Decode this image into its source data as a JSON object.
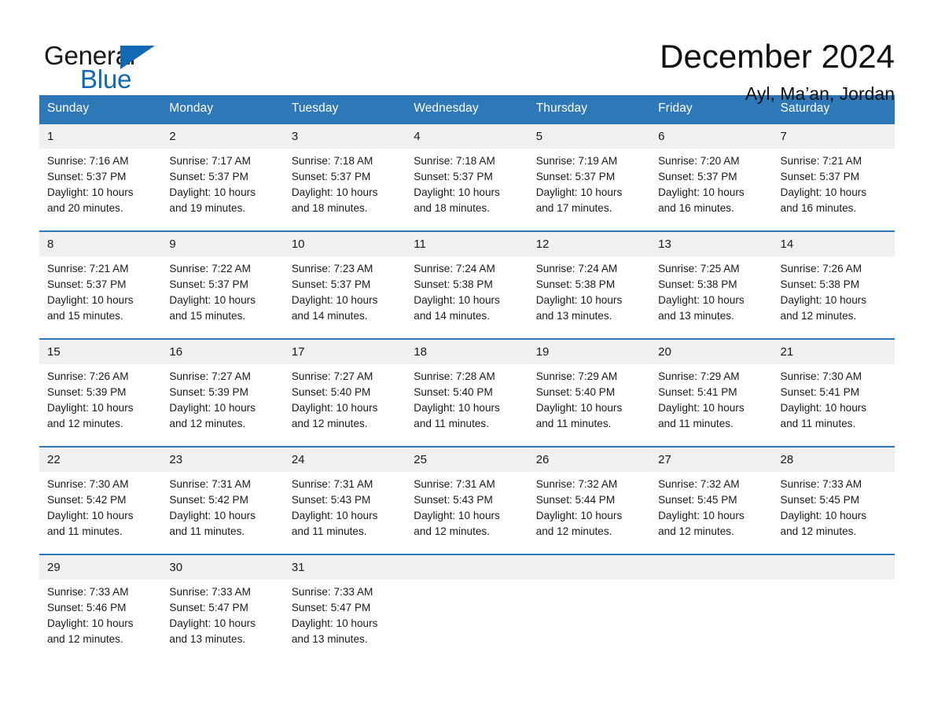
{
  "brand": {
    "name_part1": "General",
    "name_part2": "Blue",
    "triangle_color": "#1268b3",
    "text_color": "#1a1a1a"
  },
  "header": {
    "title": "December 2024",
    "subtitle": "Ayl, Ma’an, Jordan",
    "accent_color": "#2f78b8",
    "daynum_band_color": "#f0f0f0"
  },
  "calendar": {
    "weekdays": [
      "Sunday",
      "Monday",
      "Tuesday",
      "Wednesday",
      "Thursday",
      "Friday",
      "Saturday"
    ],
    "weeks": [
      [
        {
          "day": "1",
          "sunrise": "Sunrise: 7:16 AM",
          "sunset": "Sunset: 5:37 PM",
          "daylight_1": "Daylight: 10 hours",
          "daylight_2": "and 20 minutes."
        },
        {
          "day": "2",
          "sunrise": "Sunrise: 7:17 AM",
          "sunset": "Sunset: 5:37 PM",
          "daylight_1": "Daylight: 10 hours",
          "daylight_2": "and 19 minutes."
        },
        {
          "day": "3",
          "sunrise": "Sunrise: 7:18 AM",
          "sunset": "Sunset: 5:37 PM",
          "daylight_1": "Daylight: 10 hours",
          "daylight_2": "and 18 minutes."
        },
        {
          "day": "4",
          "sunrise": "Sunrise: 7:18 AM",
          "sunset": "Sunset: 5:37 PM",
          "daylight_1": "Daylight: 10 hours",
          "daylight_2": "and 18 minutes."
        },
        {
          "day": "5",
          "sunrise": "Sunrise: 7:19 AM",
          "sunset": "Sunset: 5:37 PM",
          "daylight_1": "Daylight: 10 hours",
          "daylight_2": "and 17 minutes."
        },
        {
          "day": "6",
          "sunrise": "Sunrise: 7:20 AM",
          "sunset": "Sunset: 5:37 PM",
          "daylight_1": "Daylight: 10 hours",
          "daylight_2": "and 16 minutes."
        },
        {
          "day": "7",
          "sunrise": "Sunrise: 7:21 AM",
          "sunset": "Sunset: 5:37 PM",
          "daylight_1": "Daylight: 10 hours",
          "daylight_2": "and 16 minutes."
        }
      ],
      [
        {
          "day": "8",
          "sunrise": "Sunrise: 7:21 AM",
          "sunset": "Sunset: 5:37 PM",
          "daylight_1": "Daylight: 10 hours",
          "daylight_2": "and 15 minutes."
        },
        {
          "day": "9",
          "sunrise": "Sunrise: 7:22 AM",
          "sunset": "Sunset: 5:37 PM",
          "daylight_1": "Daylight: 10 hours",
          "daylight_2": "and 15 minutes."
        },
        {
          "day": "10",
          "sunrise": "Sunrise: 7:23 AM",
          "sunset": "Sunset: 5:37 PM",
          "daylight_1": "Daylight: 10 hours",
          "daylight_2": "and 14 minutes."
        },
        {
          "day": "11",
          "sunrise": "Sunrise: 7:24 AM",
          "sunset": "Sunset: 5:38 PM",
          "daylight_1": "Daylight: 10 hours",
          "daylight_2": "and 14 minutes."
        },
        {
          "day": "12",
          "sunrise": "Sunrise: 7:24 AM",
          "sunset": "Sunset: 5:38 PM",
          "daylight_1": "Daylight: 10 hours",
          "daylight_2": "and 13 minutes."
        },
        {
          "day": "13",
          "sunrise": "Sunrise: 7:25 AM",
          "sunset": "Sunset: 5:38 PM",
          "daylight_1": "Daylight: 10 hours",
          "daylight_2": "and 13 minutes."
        },
        {
          "day": "14",
          "sunrise": "Sunrise: 7:26 AM",
          "sunset": "Sunset: 5:38 PM",
          "daylight_1": "Daylight: 10 hours",
          "daylight_2": "and 12 minutes."
        }
      ],
      [
        {
          "day": "15",
          "sunrise": "Sunrise: 7:26 AM",
          "sunset": "Sunset: 5:39 PM",
          "daylight_1": "Daylight: 10 hours",
          "daylight_2": "and 12 minutes."
        },
        {
          "day": "16",
          "sunrise": "Sunrise: 7:27 AM",
          "sunset": "Sunset: 5:39 PM",
          "daylight_1": "Daylight: 10 hours",
          "daylight_2": "and 12 minutes."
        },
        {
          "day": "17",
          "sunrise": "Sunrise: 7:27 AM",
          "sunset": "Sunset: 5:40 PM",
          "daylight_1": "Daylight: 10 hours",
          "daylight_2": "and 12 minutes."
        },
        {
          "day": "18",
          "sunrise": "Sunrise: 7:28 AM",
          "sunset": "Sunset: 5:40 PM",
          "daylight_1": "Daylight: 10 hours",
          "daylight_2": "and 11 minutes."
        },
        {
          "day": "19",
          "sunrise": "Sunrise: 7:29 AM",
          "sunset": "Sunset: 5:40 PM",
          "daylight_1": "Daylight: 10 hours",
          "daylight_2": "and 11 minutes."
        },
        {
          "day": "20",
          "sunrise": "Sunrise: 7:29 AM",
          "sunset": "Sunset: 5:41 PM",
          "daylight_1": "Daylight: 10 hours",
          "daylight_2": "and 11 minutes."
        },
        {
          "day": "21",
          "sunrise": "Sunrise: 7:30 AM",
          "sunset": "Sunset: 5:41 PM",
          "daylight_1": "Daylight: 10 hours",
          "daylight_2": "and 11 minutes."
        }
      ],
      [
        {
          "day": "22",
          "sunrise": "Sunrise: 7:30 AM",
          "sunset": "Sunset: 5:42 PM",
          "daylight_1": "Daylight: 10 hours",
          "daylight_2": "and 11 minutes."
        },
        {
          "day": "23",
          "sunrise": "Sunrise: 7:31 AM",
          "sunset": "Sunset: 5:42 PM",
          "daylight_1": "Daylight: 10 hours",
          "daylight_2": "and 11 minutes."
        },
        {
          "day": "24",
          "sunrise": "Sunrise: 7:31 AM",
          "sunset": "Sunset: 5:43 PM",
          "daylight_1": "Daylight: 10 hours",
          "daylight_2": "and 11 minutes."
        },
        {
          "day": "25",
          "sunrise": "Sunrise: 7:31 AM",
          "sunset": "Sunset: 5:43 PM",
          "daylight_1": "Daylight: 10 hours",
          "daylight_2": "and 12 minutes."
        },
        {
          "day": "26",
          "sunrise": "Sunrise: 7:32 AM",
          "sunset": "Sunset: 5:44 PM",
          "daylight_1": "Daylight: 10 hours",
          "daylight_2": "and 12 minutes."
        },
        {
          "day": "27",
          "sunrise": "Sunrise: 7:32 AM",
          "sunset": "Sunset: 5:45 PM",
          "daylight_1": "Daylight: 10 hours",
          "daylight_2": "and 12 minutes."
        },
        {
          "day": "28",
          "sunrise": "Sunrise: 7:33 AM",
          "sunset": "Sunset: 5:45 PM",
          "daylight_1": "Daylight: 10 hours",
          "daylight_2": "and 12 minutes."
        }
      ],
      [
        {
          "day": "29",
          "sunrise": "Sunrise: 7:33 AM",
          "sunset": "Sunset: 5:46 PM",
          "daylight_1": "Daylight: 10 hours",
          "daylight_2": "and 12 minutes."
        },
        {
          "day": "30",
          "sunrise": "Sunrise: 7:33 AM",
          "sunset": "Sunset: 5:47 PM",
          "daylight_1": "Daylight: 10 hours",
          "daylight_2": "and 13 minutes."
        },
        {
          "day": "31",
          "sunrise": "Sunrise: 7:33 AM",
          "sunset": "Sunset: 5:47 PM",
          "daylight_1": "Daylight: 10 hours",
          "daylight_2": "and 13 minutes."
        },
        {
          "day": "",
          "sunrise": "",
          "sunset": "",
          "daylight_1": "",
          "daylight_2": ""
        },
        {
          "day": "",
          "sunrise": "",
          "sunset": "",
          "daylight_1": "",
          "daylight_2": ""
        },
        {
          "day": "",
          "sunrise": "",
          "sunset": "",
          "daylight_1": "",
          "daylight_2": ""
        },
        {
          "day": "",
          "sunrise": "",
          "sunset": "",
          "daylight_1": "",
          "daylight_2": ""
        }
      ]
    ]
  }
}
